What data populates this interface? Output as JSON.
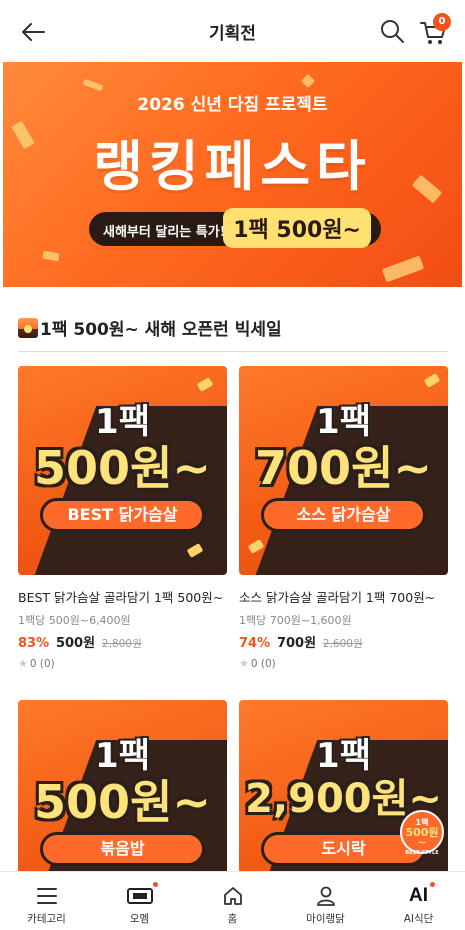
{
  "header": {
    "title": "기획전",
    "cart_count": "0"
  },
  "hero": {
    "subtitle": "2026 신년 다짐 프로젝트",
    "title": "랭킹페스타",
    "pill_left": "새해부터 달리는 특가!",
    "pill_right": "1팩 500원~"
  },
  "section": {
    "title": "1팩 500원~ 새해 오픈런 빅세일"
  },
  "products": [
    {
      "thumb_line1": "1팩",
      "thumb_line2": "500원~",
      "thumb_pill": "BEST 닭가슴살",
      "name": "BEST 닭가슴살 골라담기 1팩 500원~",
      "unit_price": "1팩당 500원~6,400원",
      "discount": "83%",
      "price": "500원",
      "original_price": "2,800원",
      "rating": "0 (0)"
    },
    {
      "thumb_line1": "1팩",
      "thumb_line2": "700원~",
      "thumb_pill": "소스 닭가슴살",
      "name": "소스 닭가슴살 골라담기 1팩 700원~",
      "unit_price": "1팩당 700원~1,600원",
      "discount": "74%",
      "price": "700원",
      "original_price": "2,600원",
      "rating": "0 (0)"
    },
    {
      "thumb_line1": "1팩",
      "thumb_line2": "500원~",
      "thumb_pill": "볶음밥"
    },
    {
      "thumb_line1": "1팩",
      "thumb_line2": "2,900원~",
      "thumb_pill": "도시락",
      "stamp_top": "1팩",
      "stamp_big": "500원~",
      "stamp_bottom": "BEST STYLE"
    }
  ],
  "nav": {
    "items": [
      {
        "label": "카테고리",
        "icon": "menu-icon"
      },
      {
        "label": "오멤",
        "icon": "membership-icon"
      },
      {
        "label": "홈",
        "icon": "home-icon"
      },
      {
        "label": "마이랭닭",
        "icon": "user-icon"
      },
      {
        "label": "AI식단",
        "icon": "ai-icon",
        "icon_text": "AI"
      }
    ]
  },
  "colors": {
    "accent": "#f2551c",
    "banner": "#ff6a1f",
    "dark": "#2b1f1a",
    "highlight": "#ffe27a"
  }
}
